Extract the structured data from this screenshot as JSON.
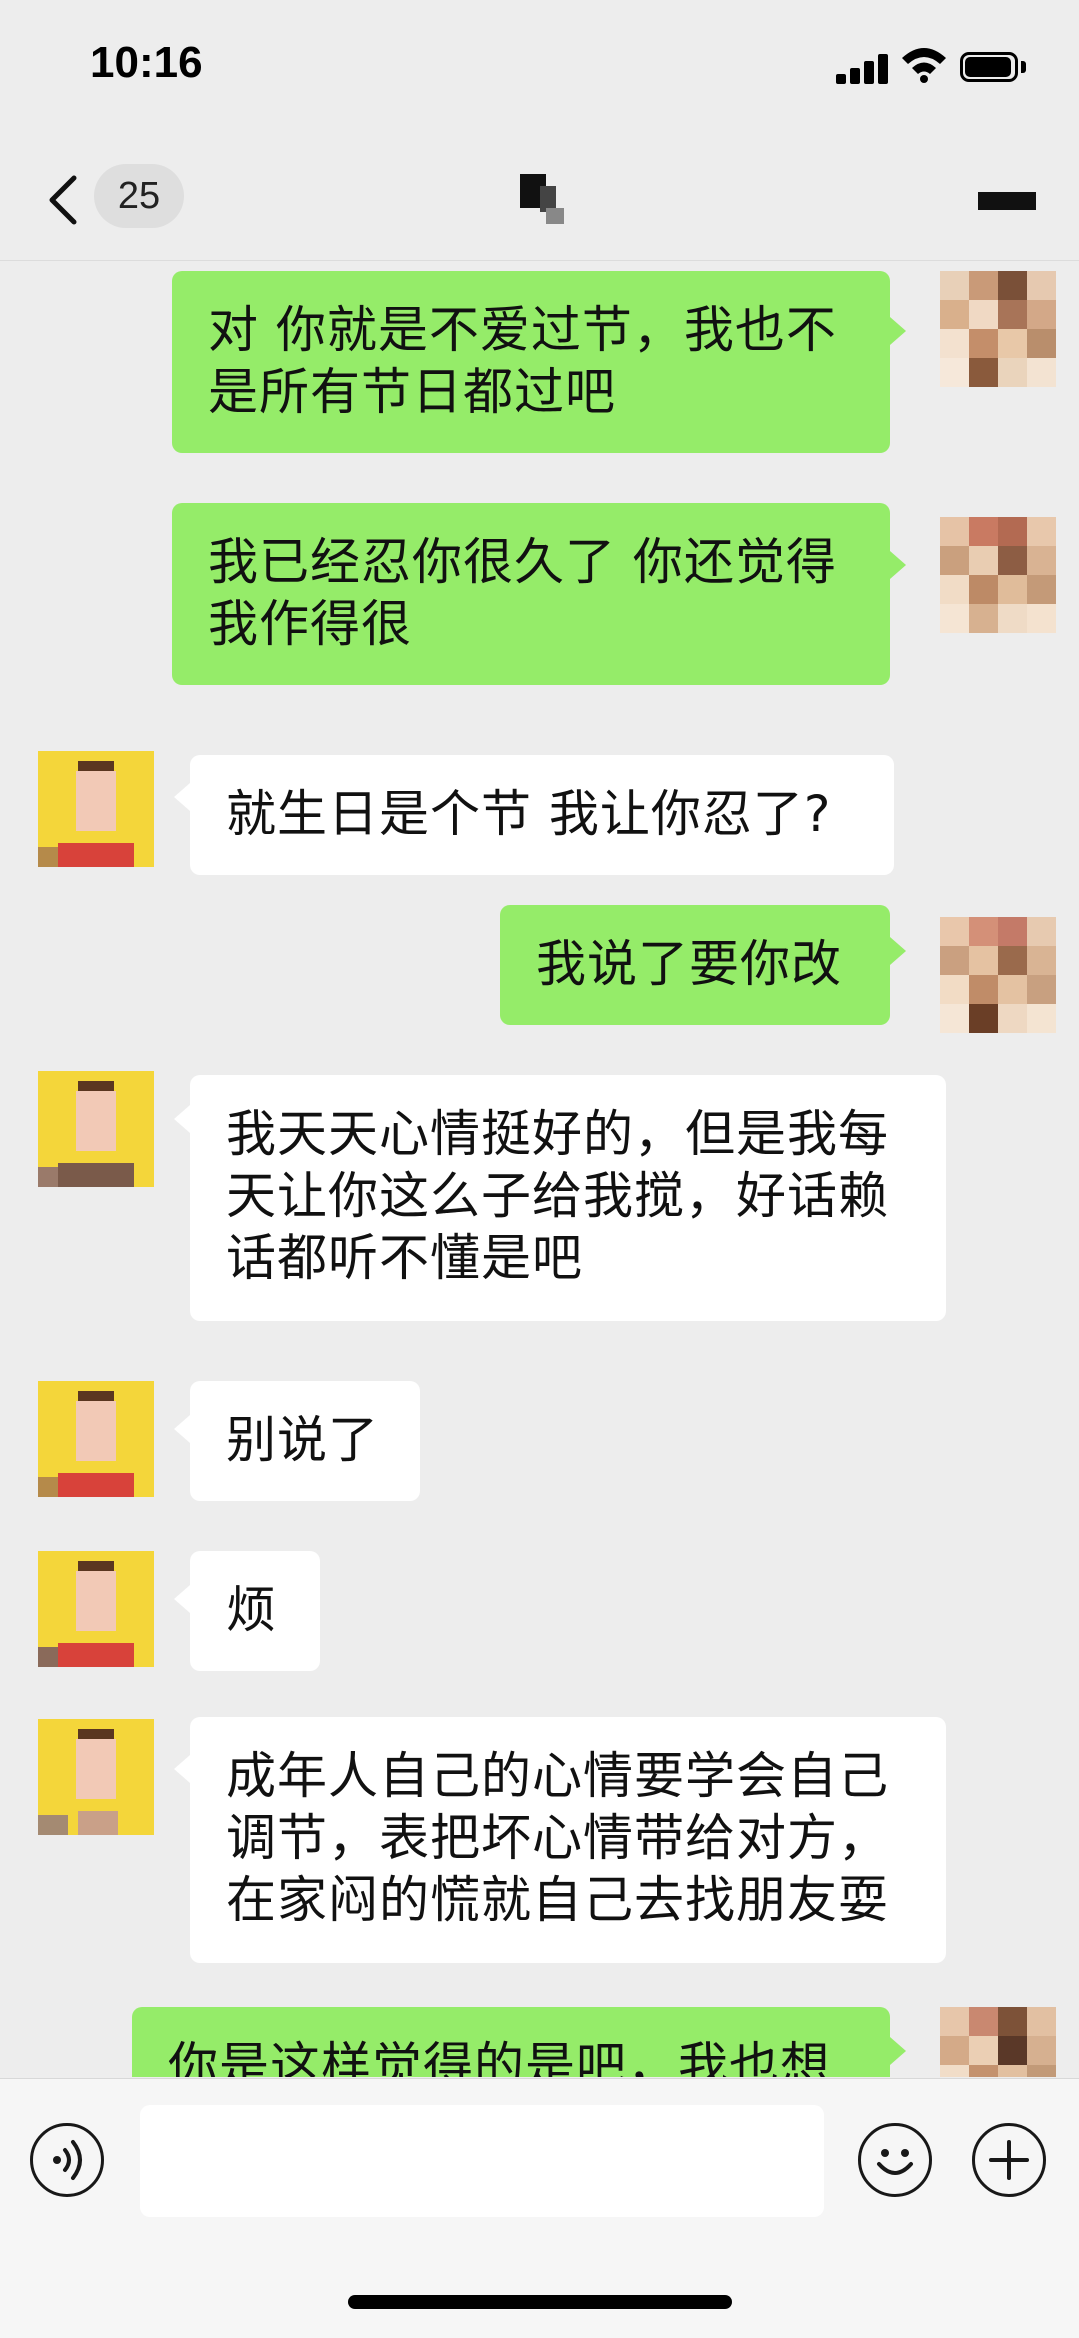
{
  "status_bar": {
    "time": "10:16"
  },
  "nav": {
    "unread_count": "25"
  },
  "messages": [
    {
      "side": "me",
      "text": "对 你就是不爱过节，我也不\n是所有节日都过吧"
    },
    {
      "side": "me",
      "text": "我已经忍你很久了 你还觉得\n我作得很"
    },
    {
      "side": "other",
      "text": "就生日是个节 我让你忍了?"
    },
    {
      "side": "me",
      "text": "我说了要你改"
    },
    {
      "side": "other",
      "text": "我天天心情挺好的，但是我每\n天让你这么子给我搅，好话赖\n话都听不懂是吧"
    },
    {
      "side": "other",
      "text": "别说了"
    },
    {
      "side": "other",
      "text": "烦"
    },
    {
      "side": "other",
      "text": "成年人自己的心情要学会自己\n调节，表把坏心情带给对方，\n在家闷的慌就自己去找朋友耍"
    },
    {
      "side": "me",
      "text": "你是这样觉得的是吧，我也想"
    }
  ],
  "icons": {
    "back": "chevron-left-icon",
    "more": "more-icon",
    "voice": "voice-icon",
    "emoji": "emoji-icon",
    "plus": "plus-icon"
  },
  "colors": {
    "my_bubble": "#95ec69",
    "other_bubble": "#ffffff",
    "background": "#ededed"
  }
}
